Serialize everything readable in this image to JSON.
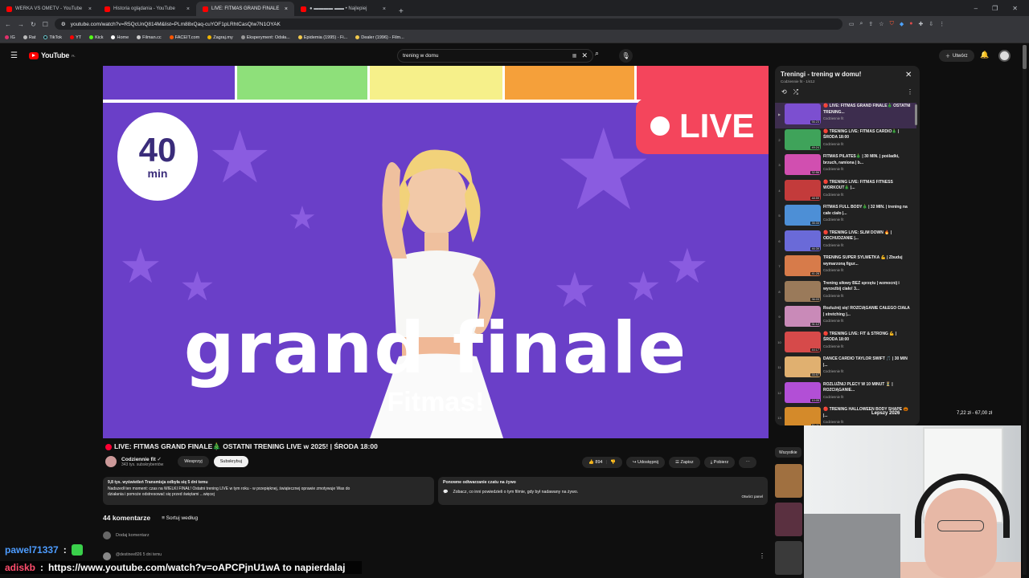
{
  "browser": {
    "tabs": [
      {
        "title": "WERKA VS OMETV - YouTube",
        "active": false
      },
      {
        "title": "Historia oglądania - YouTube",
        "active": false
      },
      {
        "title": "LIVE: FITMAS GRAND FINALE",
        "active": true
      },
      {
        "title": "● ▬▬▬▬ ▬▬ • Najlepiej",
        "active": false
      }
    ],
    "new_tab": "+",
    "url": "youtube.com/watch?v=R5QcUnQ814M&list=PLm88xQaq-cuYOF1pLRhtCasQIw7N1OYAK",
    "bookmarks": [
      "IG",
      "Rat",
      "TikTok",
      "YT",
      "Kick",
      "Home",
      "Filman.cc",
      "FACEIT.com",
      "Zagraj.my",
      "Eksperyment: Odsła...",
      "Epidemia (1995) - Fi...",
      "Dealer (1996) - Film..."
    ]
  },
  "youtube": {
    "logo": "YouTube",
    "logo_sup": "PL",
    "search_value": "trening w domu",
    "create_label": "Utwórz"
  },
  "video": {
    "thumb_timer_num": "40",
    "thumb_timer_unit": "min",
    "thumb_live": "LIVE",
    "thumb_title": "grand finale",
    "thumb_brand": "Fitmas!",
    "stripe_colors": [
      "#6a3fc8",
      "#8ee07a",
      "#f6f08a",
      "#f5a03a",
      "#f4455c"
    ],
    "title": "LIVE: FITMAS GRAND FINALE🎄 OSTATNI TRENING LIVE w 2025! | ŚRODA 18:00",
    "channel": "Codziennie fit",
    "subs": "343 tys. subskrybentów",
    "support_label": "Wesprzyj",
    "subscribe_label": "Subskrybuj",
    "likes": "894",
    "share_label": "Udostępnij",
    "save_label": "Zapisz",
    "download_label": "Pobierz",
    "desc_line1": "9,8 tys. wyświetleń  Transmisja odbyła się 5 dni temu",
    "desc_line2": "Nadszedł ten moment: czas na WIELKI FINAŁ! Ostatni trening LIVE w tym roku - w przepięknej, świątecznej oprawie zmotywuje Was do",
    "desc_line3": "działania i pomoże odstresować się przed świętami ...więcej",
    "rerun_title": "Ponowne odtwarzanie czatu na żywo",
    "rerun_text": "Zobacz, co inni powiedzieli o tym filmie, gdy był nadawany na żywo.",
    "rerun_btn": "Otwórz panel",
    "comments_count": "44 komentarze",
    "sort_label": "Sortuj według",
    "add_comment": "Dodaj komentarz",
    "first_comment": "@destinee826  5 dni temu"
  },
  "playlist": {
    "title": "Treningi  - trening w domu!",
    "sub": "Codziennie fit - 1/412",
    "items": [
      {
        "idx": "▶",
        "title": "🔴 LIVE: FITMAS GRAND FINALE🎄 OSTATNI TRENING...",
        "channel": "Codziennie fit",
        "dur": "56:23",
        "color": "#7c4fd0"
      },
      {
        "idx": "2",
        "title": "🔴 TRENING LIVE: FITMAS CARDIO🎄 | ŚRODA 18:00",
        "channel": "Codziennie fit",
        "dur": "49:24",
        "color": "#3fa35a"
      },
      {
        "idx": "3",
        "title": "FITMAS PILATES🎄 | 30 MIN. | pośladki, brzuch, ramiona | b...",
        "channel": "Codziennie fit",
        "dur": "32:56",
        "color": "#d14fb0"
      },
      {
        "idx": "4",
        "title": "🔴 TRENING LIVE: FITMAS FITNESS WORKOUT🎄 |...",
        "channel": "Codziennie fit",
        "dur": "48:59",
        "color": "#c33b3b"
      },
      {
        "idx": "5",
        "title": "FITMAS FULL BODY🎄 | 32 MIN. | trening na całe ciało |...",
        "channel": "Codziennie fit",
        "dur": "35:33",
        "color": "#4d8fd6"
      },
      {
        "idx": "6",
        "title": "🔴 TRENING LIVE: SLIM DOWN 🔥 | ODCHUDZANIE |...",
        "channel": "Codziennie fit",
        "dur": "46:39",
        "color": "#6a6ad8"
      },
      {
        "idx": "7",
        "title": "TRENING SUPER SYLWETKA 💪 | Zbuduj wymarzoną figur...",
        "channel": "Codziennie fit",
        "dur": "41:28",
        "color": "#d77b4a"
      },
      {
        "idx": "8",
        "title": "Trening siłowy BEZ sprzętu | wzmocnij i wyrzeźbij ciało! 3...",
        "channel": "Codziennie fit",
        "dur": "36:03",
        "color": "#9a7a5a"
      },
      {
        "idx": "9",
        "title": "Rozluźnij się! ROZCIĄGANIE CAŁEGO CIAŁA | stretching |...",
        "channel": "Codziennie fit",
        "dur": "31:12",
        "color": "#c98ab8"
      },
      {
        "idx": "10",
        "title": "🔴 TRENING LIVE: FIT & STRONG 💪 | ŚRODA 18:00",
        "channel": "Codziennie fit",
        "dur": "44:17",
        "color": "#d64a4a"
      },
      {
        "idx": "11",
        "title": "DANCE CARDIO TAYLOR SWIFT 🎵 | 30 MIN |...",
        "channel": "Codziennie fit",
        "dur": "33:57",
        "color": "#e0b070"
      },
      {
        "idx": "12",
        "title": "ROZLUŹNIJ PLECY W 10 MINUT ⏳ | ROZCIĄGANIE...",
        "channel": "Codziennie fit",
        "dur": "10:05",
        "color": "#b24fd6"
      },
      {
        "idx": "13",
        "title": "🔴 TRENING HALLOWEEN BODY SHAPE 🎃 |...",
        "channel": "Codziennie fit",
        "dur": "51:11",
        "color": "#d48a2a"
      }
    ]
  },
  "overlay": {
    "label": "Lepszy 2026",
    "price": "7,22 zł - 67,00 zł",
    "filter_chip": "Wszystkie"
  },
  "chat": [
    {
      "user": "pawel71337",
      "msg": ""
    },
    {
      "user": "adiskb",
      "msg": "https://www.youtube.com/watch?v=oAPCPjnU1wA to napierdalaj"
    }
  ]
}
